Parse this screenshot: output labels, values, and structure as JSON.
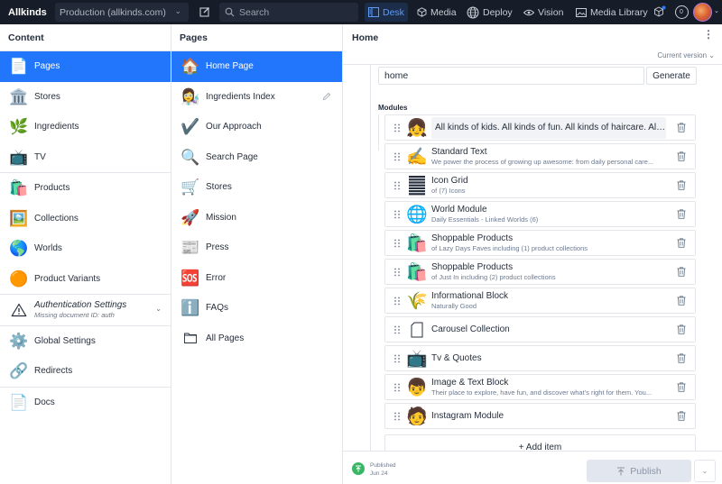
{
  "navbar": {
    "brand": "Allkinds",
    "environment": "Production (allkinds.com)",
    "search_placeholder": "Search",
    "tools": [
      {
        "label": "Desk",
        "icon": "desk-icon",
        "active": true
      },
      {
        "label": "Media",
        "icon": "media-icon",
        "active": false
      },
      {
        "label": "Deploy",
        "icon": "globe-icon",
        "active": false
      },
      {
        "label": "Vision",
        "icon": "eye-icon",
        "active": false
      },
      {
        "label": "Media Library",
        "icon": "image-icon",
        "active": false
      }
    ],
    "notification_count": "0"
  },
  "content_pane": {
    "title": "Content",
    "items": [
      {
        "label": "Pages",
        "icon": "📄",
        "selected": true
      },
      {
        "label": "Stores",
        "icon": "🏛️"
      },
      {
        "label": "Ingredients",
        "icon": "🌿"
      },
      {
        "label": "TV",
        "icon": "📺"
      },
      {
        "label": "Products",
        "icon": "🛍️"
      },
      {
        "label": "Collections",
        "icon": "🖼️"
      },
      {
        "label": "Worlds",
        "icon": "🌎"
      },
      {
        "label": "Product Variants",
        "icon": "🟠"
      },
      {
        "label": "Authentication Settings",
        "sublabel": "Missing document ID: auth",
        "icon": "⚠"
      },
      {
        "label": "Global Settings",
        "icon": "⚙️"
      },
      {
        "label": "Redirects",
        "icon": "🔗"
      },
      {
        "label": "Docs",
        "icon": "📄"
      }
    ]
  },
  "pages_pane": {
    "title": "Pages",
    "items": [
      {
        "label": "Home Page",
        "icon": "🏠",
        "selected": true
      },
      {
        "label": "Ingredients Index",
        "icon": "👩‍🔬"
      },
      {
        "label": "Our Approach",
        "icon": "✔️"
      },
      {
        "label": "Search Page",
        "icon": "🔍"
      },
      {
        "label": "Stores",
        "icon": "🛒"
      },
      {
        "label": "Mission",
        "icon": "🚀"
      },
      {
        "label": "Press",
        "icon": "📰"
      },
      {
        "label": "Error",
        "icon": "🆘"
      },
      {
        "label": "FAQs",
        "icon": "ℹ️"
      },
      {
        "label": "All Pages",
        "icon": "folder"
      }
    ]
  },
  "document": {
    "title": "Home",
    "version": "Current version",
    "slug_value": "home",
    "generate_label": "Generate",
    "modules_label": "Modules",
    "modules": [
      {
        "title": "All kinds of kids. All kinds of fun. All kinds of haircare. All kin...",
        "subtitle": "",
        "thumb": "👧"
      },
      {
        "title": "Standard Text",
        "subtitle": "We power the process of growing up awesome: from daily personal care...",
        "thumb": "✍️"
      },
      {
        "title": "Icon Grid",
        "subtitle": "of (7) Icons",
        "thumb": "☰"
      },
      {
        "title": "World Module",
        "subtitle": "Daily Essentials - Linked Worlds (6)",
        "thumb": "🌐"
      },
      {
        "title": "Shoppable Products",
        "subtitle": "of Lazy Days Faves including (1) product collections",
        "thumb": "🛍️"
      },
      {
        "title": "Shoppable Products",
        "subtitle": "of Just In including (2) product collections",
        "thumb": "🛍️"
      },
      {
        "title": "Informational Block",
        "subtitle": "Naturally Good",
        "thumb": "🌾"
      },
      {
        "title": "Carousel Collection",
        "subtitle": "",
        "thumb": "doc"
      },
      {
        "title": "Tv & Quotes",
        "subtitle": "",
        "thumb": "📺"
      },
      {
        "title": "Image & Text Block",
        "subtitle": "Their place to explore, have fun, and discover what's right for them. You...",
        "thumb": "👦"
      },
      {
        "title": "Instagram Module",
        "subtitle": "",
        "thumb": "🧑"
      }
    ],
    "add_item_label": "+ Add item",
    "status_label": "Published",
    "status_date": "Jun 24",
    "publish_label": "Publish",
    "colors": {
      "accent": "#2276fc",
      "published": "#3ab667"
    }
  }
}
